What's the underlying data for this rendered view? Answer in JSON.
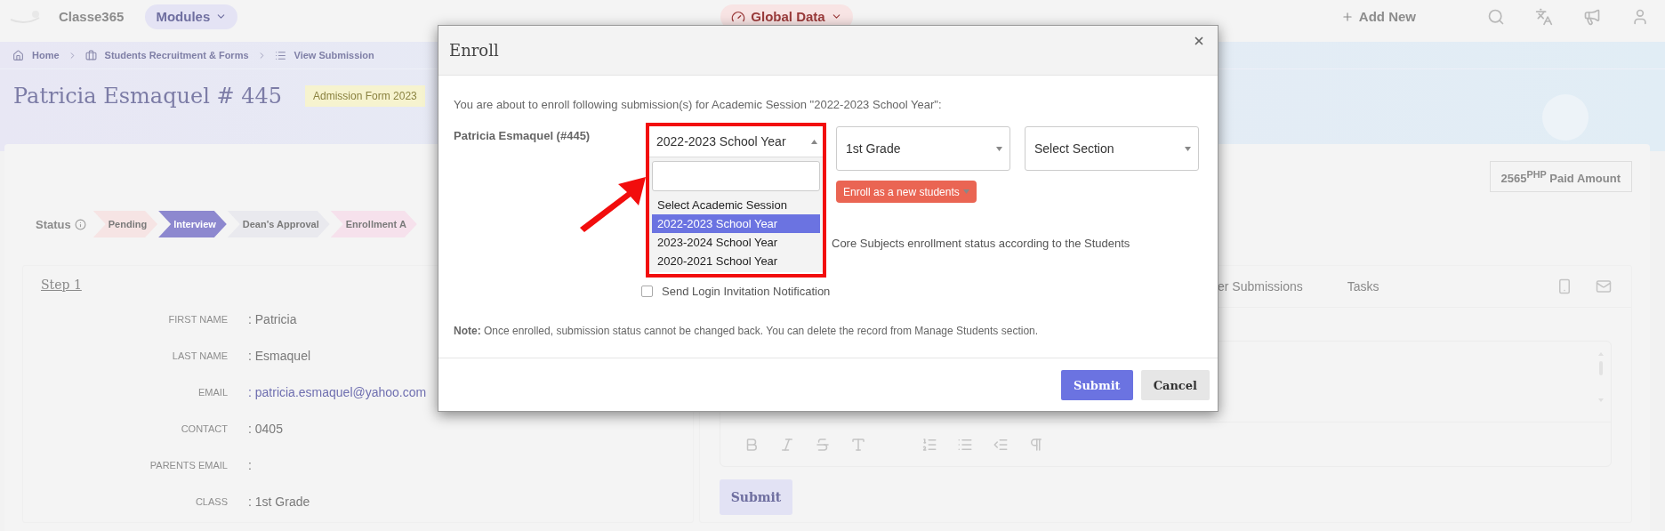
{
  "top_bar": {
    "brand": "Classe365",
    "modules": "Modules",
    "global_data": "Global Data",
    "add_new": "Add New"
  },
  "breadcrumb": [
    {
      "label": "Home"
    },
    {
      "label": "Students Recruitment & Forms"
    },
    {
      "label": "View Submission"
    }
  ],
  "header": {
    "title": "Patricia Esmaquel # 445",
    "badge": "Admission Form 2023"
  },
  "paid_amount": "2565$^{PHP}$ Paid Amount",
  "status": {
    "label": "Status",
    "steps": [
      {
        "label": "Pending",
        "selected": false,
        "color": "#f6e4e4"
      },
      {
        "label": "Interview",
        "selected": true,
        "color": "#8d88cf"
      },
      {
        "label": "Dean's Approval",
        "selected": false,
        "color": "#e9e9ee"
      },
      {
        "label": "Enrollment A",
        "selected": false,
        "color": "#f6e1ec"
      }
    ]
  },
  "step": {
    "title": "Step 1",
    "fields": [
      {
        "label": "FIRST NAME",
        "value": ": Patricia",
        "kind": "text"
      },
      {
        "label": "LAST NAME",
        "value": ": Esmaquel",
        "kind": "text"
      },
      {
        "label": "EMAIL",
        "value": ": patricia.esmaquel@yahoo.com",
        "kind": "link"
      },
      {
        "label": "CONTACT",
        "value": ": 0405",
        "kind": "text"
      },
      {
        "label": "PARENTS EMAIL",
        "value": ":",
        "kind": "text"
      },
      {
        "label": "CLASS",
        "value": ": 1st Grade",
        "kind": "text"
      }
    ]
  },
  "side_panel": {
    "tabs": [
      {
        "label": "er Submissions",
        "selected": false
      },
      {
        "label": "Tasks",
        "selected": false
      }
    ],
    "submit": "Submit"
  },
  "dialog": {
    "title": "Enroll",
    "intro": "You are about to enroll following submission(s) for Academic Session \"2022-2023 School Year\":",
    "student": "Patricia Esmaquel (#445)",
    "session_select": {
      "value": "2022-2023 School Year",
      "expanded": true,
      "options": [
        {
          "label": "Select Academic Session",
          "selected": false
        },
        {
          "label": "2022-2023 School Year",
          "selected": true
        },
        {
          "label": "2023-2024 School Year",
          "selected": false
        },
        {
          "label": "2020-2021 School Year",
          "selected": false
        }
      ]
    },
    "grade_select": "1st Grade",
    "section_select": "Select Section",
    "enroll_button": "Enroll as a new students",
    "core_subjects_text": "Core Subjects enrollment status according to the Students",
    "login_invitation": {
      "label": "Send Login Invitation Notification",
      "checked": false
    },
    "note": "**Note:** Once enrolled, submission status cannot be changed back. You can delete the record from Manage Students section.",
    "buttons": [
      {
        "label": "Submit",
        "kind": "primary"
      },
      {
        "label": "Cancel",
        "kind": "secondary"
      }
    ]
  }
}
